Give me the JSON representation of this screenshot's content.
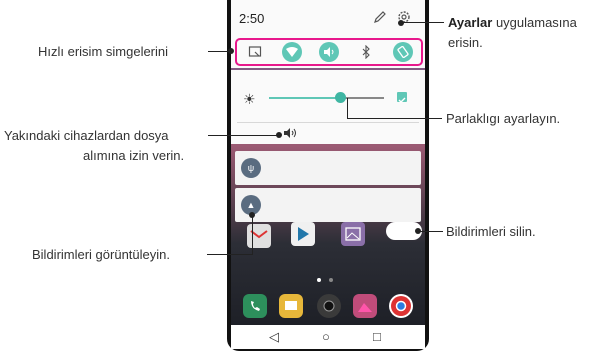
{
  "status_bar": {
    "time": "2:50"
  },
  "icons": {
    "edit": "pencil-icon",
    "settings": "gear-icon",
    "quick_settings": [
      "screen-capture-icon",
      "wifi-icon",
      "sound-icon",
      "bluetooth-icon",
      "rotation-icon"
    ],
    "brightness": "sun-icon",
    "nearby_share": "nearby-sharing-icon"
  },
  "brightness": {
    "level": 0.62,
    "auto_enabled": true
  },
  "notifications": [
    {
      "icon": "usb-icon"
    },
    {
      "icon": "warning-icon"
    }
  ],
  "home_page_indicator": {
    "pages": 2,
    "current": 0
  },
  "navbar": {
    "back": "◁",
    "home": "○",
    "recents": "□"
  },
  "callouts": {
    "settings_bold": "Ayarlar",
    "settings_rest_line1": " uygulamasına",
    "settings_rest_line2": "erisin.",
    "quick_icons": "Hızlı erisim simgelerini",
    "brightness": "Parlaklıgı ayarlayın.",
    "nearby_line1": "Yakındaki cihazlardan dosya",
    "nearby_line2": "alımına izin verin.",
    "view_notifications": "Bildirimleri görüntüleyin.",
    "clear_notifications": "Bildirimleri silin."
  },
  "colors": {
    "accent": "#5fc7b6",
    "highlight_border": "#e8188c",
    "phone_body": "#111111"
  }
}
